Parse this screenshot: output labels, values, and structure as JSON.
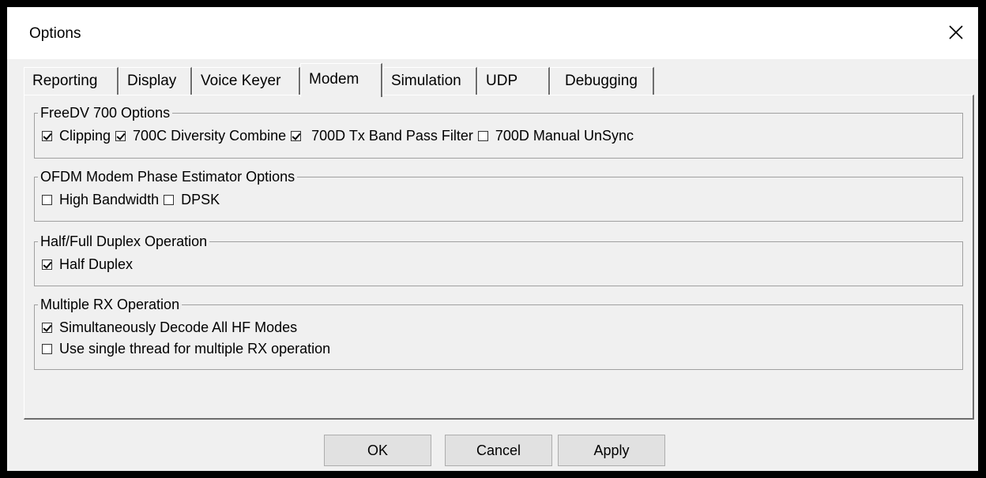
{
  "window": {
    "title": "Options",
    "close_glyph": "✕"
  },
  "tabs": [
    {
      "label": "Reporting"
    },
    {
      "label": "Display"
    },
    {
      "label": "Voice Keyer"
    },
    {
      "label": "Modem",
      "active": true
    },
    {
      "label": "Simulation"
    },
    {
      "label": "UDP"
    },
    {
      "label": "Debugging"
    }
  ],
  "groups": {
    "freedv700": {
      "title": "FreeDV 700 Options",
      "items": [
        {
          "label": "Clipping",
          "checked": true
        },
        {
          "label": "700C Diversity Combine",
          "checked": true
        },
        {
          "label": "700D Tx Band Pass Filter",
          "checked": true
        },
        {
          "label": "700D Manual UnSync",
          "checked": false
        }
      ]
    },
    "ofdm": {
      "title": "OFDM Modem Phase Estimator Options",
      "items": [
        {
          "label": "High Bandwidth",
          "checked": false
        },
        {
          "label": "DPSK",
          "checked": false
        }
      ]
    },
    "duplex": {
      "title": "Half/Full Duplex Operation",
      "items": [
        {
          "label": "Half Duplex",
          "checked": true
        }
      ]
    },
    "multirx": {
      "title": "Multiple RX Operation",
      "items": [
        {
          "label": "Simultaneously Decode All HF Modes",
          "checked": true
        },
        {
          "label": "Use single thread for multiple RX operation",
          "checked": false
        }
      ]
    }
  },
  "buttons": {
    "ok": "OK",
    "cancel": "Cancel",
    "apply": "Apply"
  }
}
